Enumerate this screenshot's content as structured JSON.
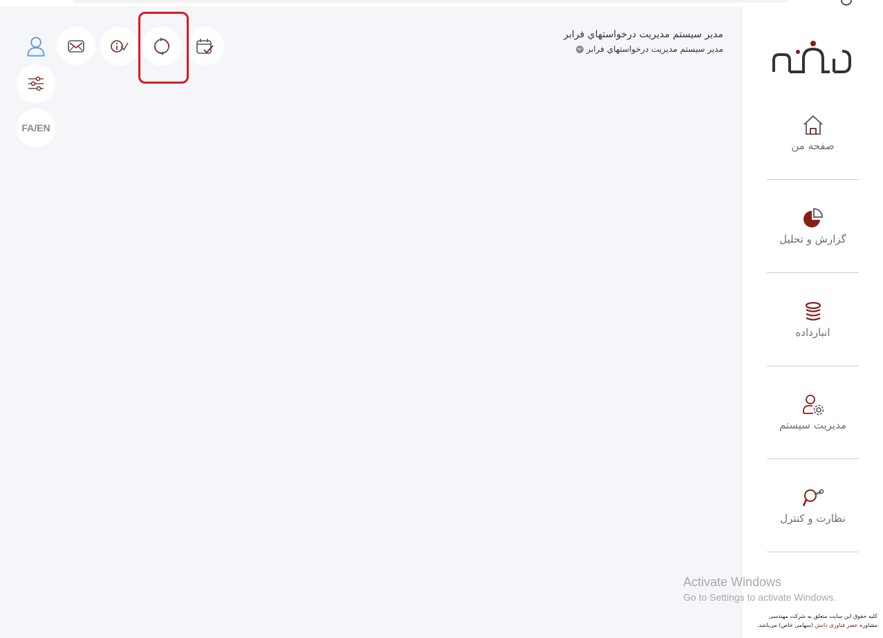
{
  "user": {
    "name": "مدير سيستم مديريت درخواستهاي فرابر",
    "role": "مدير سيستم مديريت درخواستهاي فرابر"
  },
  "toolbar": {
    "language_label": "FA/EN",
    "icons": [
      "user-icon",
      "mail-icon",
      "info-check-icon",
      "refresh-icon",
      "calendar-check-icon",
      "sliders-icon"
    ]
  },
  "sidebar": {
    "items": [
      {
        "label": "صفحه من",
        "icon": "home-icon"
      },
      {
        "label": "گزارش و تحلیل",
        "icon": "pie-chart-icon"
      },
      {
        "label": "انبارداده",
        "icon": "database-icon"
      },
      {
        "label": "مدیریت سیستم",
        "icon": "user-settings-icon"
      },
      {
        "label": "نظارت و کنترل",
        "icon": "search-key-icon"
      }
    ]
  },
  "footer": {
    "line1": "کلیه حقوق این سایت متعلق به شرکت مهندسی",
    "line2_prefix": "مشاوره ",
    "company": "عصر فناوری دانش",
    "line2_suffix": " (سهامی خاص) می‌باشد."
  },
  "watermark": {
    "title": "Activate Windows",
    "subtitle": "Go to Settings to activate Windows."
  },
  "colors": {
    "accent": "#8b1d14",
    "icon_dark": "#555555",
    "user_icon": "#5b9bd5",
    "highlight": "#e0161f",
    "background": "#f5f6fa"
  }
}
